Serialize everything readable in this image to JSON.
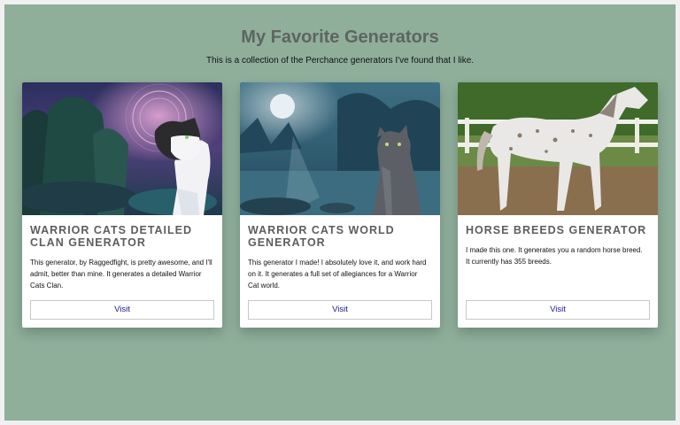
{
  "page": {
    "title": "My Favorite Generators",
    "subtitle": "This is a collection of the Perchance generators I've found that I like."
  },
  "cards": [
    {
      "title": "Warrior Cats Detailed Clan Generator",
      "description": "This generator, by Raggedfight, is pretty awesome, and I'll admit, better than mine. It generates a detailed Warrior Cats Clan.",
      "button_label": "Visit",
      "image": "white-black cat with glowing sigil in forest"
    },
    {
      "title": "Warrior Cats World Generator",
      "description": "This generator I made! I absolutely love it, and work hard on it. It generates a full set of allegiances for a Warrior Cat world.",
      "button_label": "Visit",
      "image": "gray tabby cat under full moon by lake"
    },
    {
      "title": "Horse Breeds Generator",
      "description": "I made this one. It generates you a random horse breed. It currently has 355 breeds.",
      "button_label": "Visit",
      "image": "spotted appaloosa horse in paddock"
    }
  ],
  "colors": {
    "background": "#8faf9b",
    "title": "#5f6461",
    "button_text": "#1a1a8c"
  }
}
